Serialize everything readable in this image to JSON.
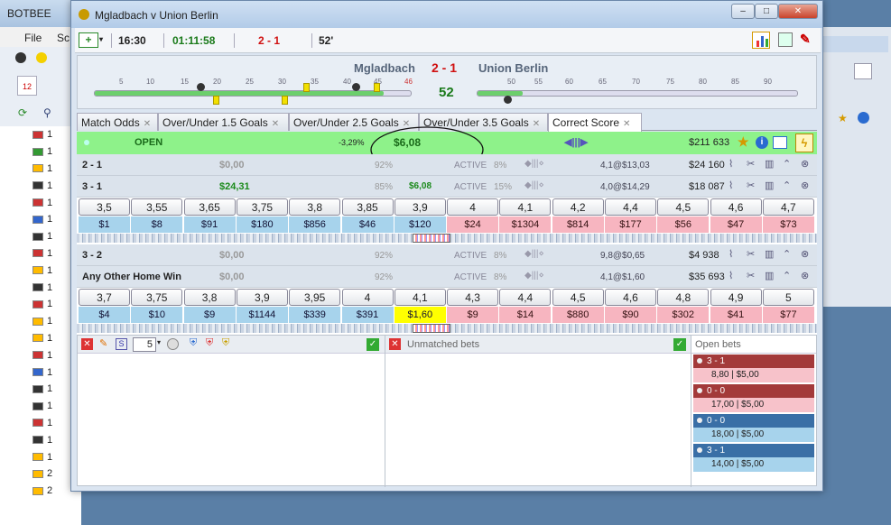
{
  "bg_window": {
    "title": "BOTBEE",
    "menu": [
      "File",
      "Sc"
    ],
    "tree_prefixes": [
      "1",
      "1",
      "1",
      "1",
      "1",
      "1",
      "1",
      "1",
      "1",
      "1",
      "1",
      "1",
      "1",
      "1",
      "1",
      "1",
      "1",
      "1",
      "1",
      "1",
      "2",
      "2"
    ]
  },
  "window": {
    "title": "Mgladbach v Union Berlin"
  },
  "toolbar": {
    "time": "16:30",
    "elapsed": "01:11:58",
    "score": "2 - 1",
    "minute": "52'"
  },
  "match": {
    "home": "Mgladbach",
    "away": "Union Berlin",
    "score": "2 - 1",
    "minute": "52",
    "timeline_ticks": [
      "5",
      "10",
      "15",
      "20",
      "25",
      "30",
      "35",
      "40",
      "45",
      "46"
    ],
    "timeline_ticks2": [
      "50",
      "55",
      "60",
      "65",
      "70",
      "75",
      "80",
      "85",
      "90"
    ]
  },
  "tabs": [
    "Match Odds",
    "Over/Under 1.5 Goals",
    "Over/Under 2.5 Goals",
    "Over/Under 3.5 Goals",
    "Correct Score"
  ],
  "open_row": {
    "status": "OPEN",
    "pct": "-3,29%",
    "price": "$6,08",
    "matched": "$211 633"
  },
  "selections": [
    {
      "name": "2 - 1",
      "pl": "$0,00",
      "pct": "92%",
      "status": "ACTIVE",
      "st_pct": "8%",
      "last": "4,1@$13,03",
      "matched": "$24 160"
    },
    {
      "name": "3 - 1",
      "pl": "$24,31",
      "pct": "85%",
      "pl2": "$6,08",
      "status": "ACTIVE",
      "st_pct": "15%",
      "last": "4,0@$14,29",
      "matched": "$18 087"
    },
    {
      "name": "3 - 2",
      "pl": "$0,00",
      "pct": "92%",
      "status": "ACTIVE",
      "st_pct": "8%",
      "last": "9,8@$0,65",
      "matched": "$4 938"
    },
    {
      "name": "Any Other Home Win",
      "pl": "$0,00",
      "pct": "92%",
      "status": "ACTIVE",
      "st_pct": "8%",
      "last": "4,1@$1,60",
      "matched": "$35 693"
    }
  ],
  "ladder1": {
    "prices": [
      "3,5",
      "3,55",
      "3,65",
      "3,75",
      "3,8",
      "3,85",
      "3,9",
      "4",
      "4,1",
      "4,2",
      "4,4",
      "4,5",
      "4,6",
      "4,7"
    ],
    "stakes": [
      "$1",
      "$8",
      "$91",
      "$180",
      "$856",
      "$46",
      "$120",
      "$24",
      "$1304",
      "$814",
      "$177",
      "$56",
      "$47",
      "$73"
    ]
  },
  "ladder2": {
    "prices": [
      "3,7",
      "3,75",
      "3,8",
      "3,9",
      "3,95",
      "4",
      "4,1",
      "4,3",
      "4,4",
      "4,5",
      "4,6",
      "4,8",
      "4,9",
      "5"
    ],
    "stakes": [
      "$4",
      "$10",
      "$9",
      "$1144",
      "$339",
      "$391",
      "$1,60",
      "$9",
      "$14",
      "$880",
      "$90",
      "$302",
      "$41",
      "$77"
    ]
  },
  "bottom": {
    "stake_value": "5",
    "unmatched_label": "Unmatched bets",
    "open_label": "Open bets",
    "open_bets": [
      {
        "sel": "3 - 1",
        "line": "8,80  |  $5,00",
        "type": "lay"
      },
      {
        "sel": "0 - 0",
        "line": "17,00  |  $5,00",
        "type": "lay"
      },
      {
        "sel": "0 - 0",
        "line": "18,00  |  $5,00",
        "type": "back"
      },
      {
        "sel": "3 - 1",
        "line": "14,00  |  $5,00",
        "type": "back"
      }
    ]
  },
  "colors": {
    "open_green": "#8ef28a",
    "back": "#a7d3ec",
    "lay": "#f7b5c0",
    "highlight": "#ffff00",
    "score_red": "#d01010",
    "timer_green": "#1a7a1a"
  }
}
